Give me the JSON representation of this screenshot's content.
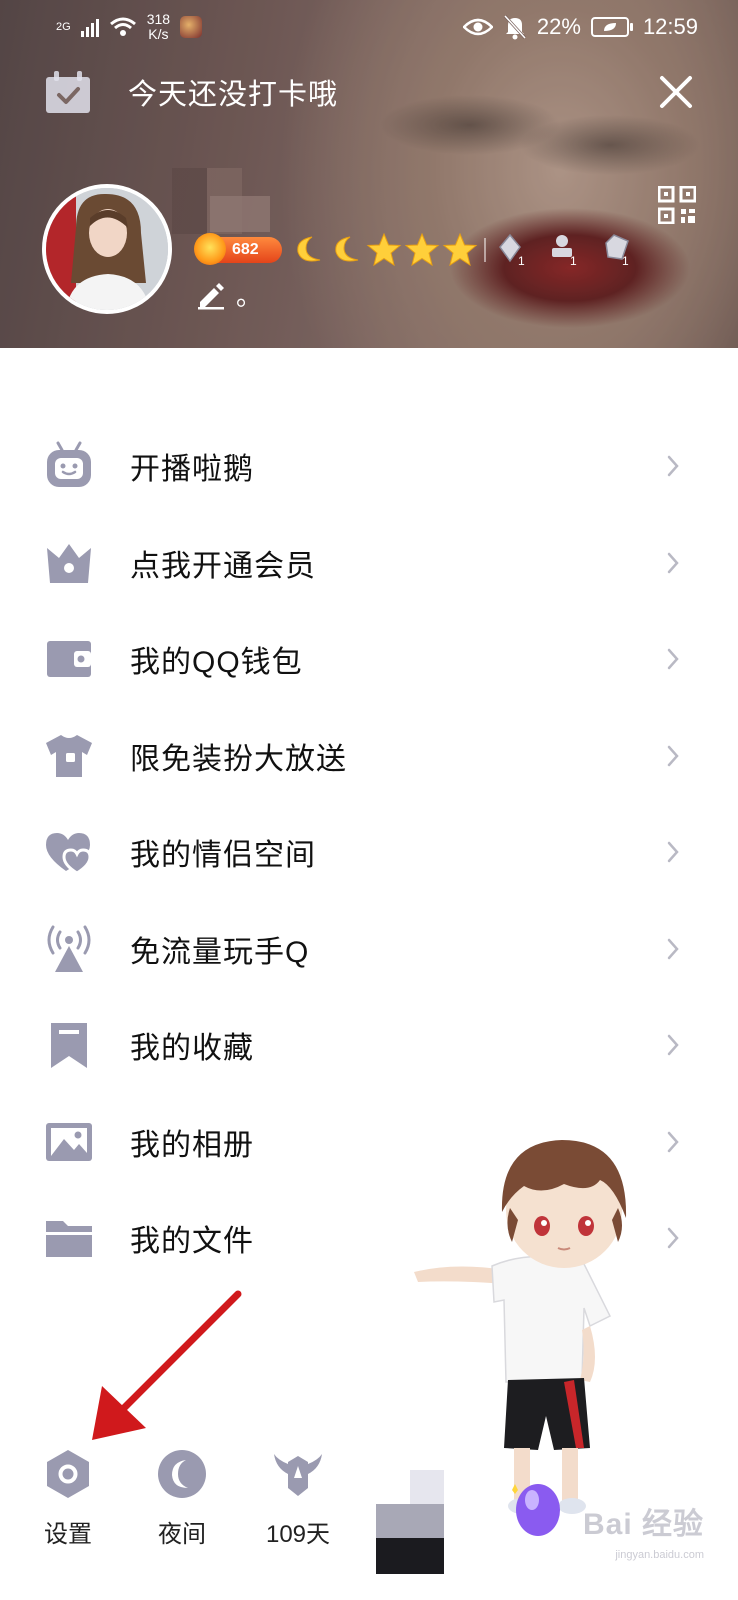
{
  "status_bar": {
    "network": "2G",
    "speed_value": "318",
    "speed_unit": "K/s",
    "battery": "22%",
    "time": "12:59"
  },
  "header": {
    "checkin_text": "今天还没打卡哦",
    "level_number": "682",
    "badge_counts": [
      "1",
      "1",
      "1"
    ],
    "signature": "。"
  },
  "menu": {
    "items": [
      {
        "label": "开播啦鹅",
        "icon": "tv-robot-icon"
      },
      {
        "label": "点我开通会员",
        "icon": "vip-crown-icon"
      },
      {
        "label": "我的QQ钱包",
        "icon": "wallet-icon"
      },
      {
        "label": "限免装扮大放送",
        "icon": "tshirt-icon"
      },
      {
        "label": "我的情侣空间",
        "icon": "couple-heart-icon"
      },
      {
        "label": "免流量玩手Q",
        "icon": "signal-tower-icon"
      },
      {
        "label": "我的收藏",
        "icon": "bookmark-icon"
      },
      {
        "label": "我的相册",
        "icon": "photo-album-icon"
      },
      {
        "label": "我的文件",
        "icon": "folder-icon"
      }
    ]
  },
  "bottom_bar": {
    "settings_label": "设置",
    "night_label": "夜间",
    "days_label": "109天"
  },
  "watermark": {
    "text": "Bai 经验",
    "url": "jingyan.baidu.com"
  },
  "colors": {
    "icon_gray": "#9a9ab0",
    "arrow_red": "#d0191c",
    "chevron": "#b9b9c4"
  }
}
